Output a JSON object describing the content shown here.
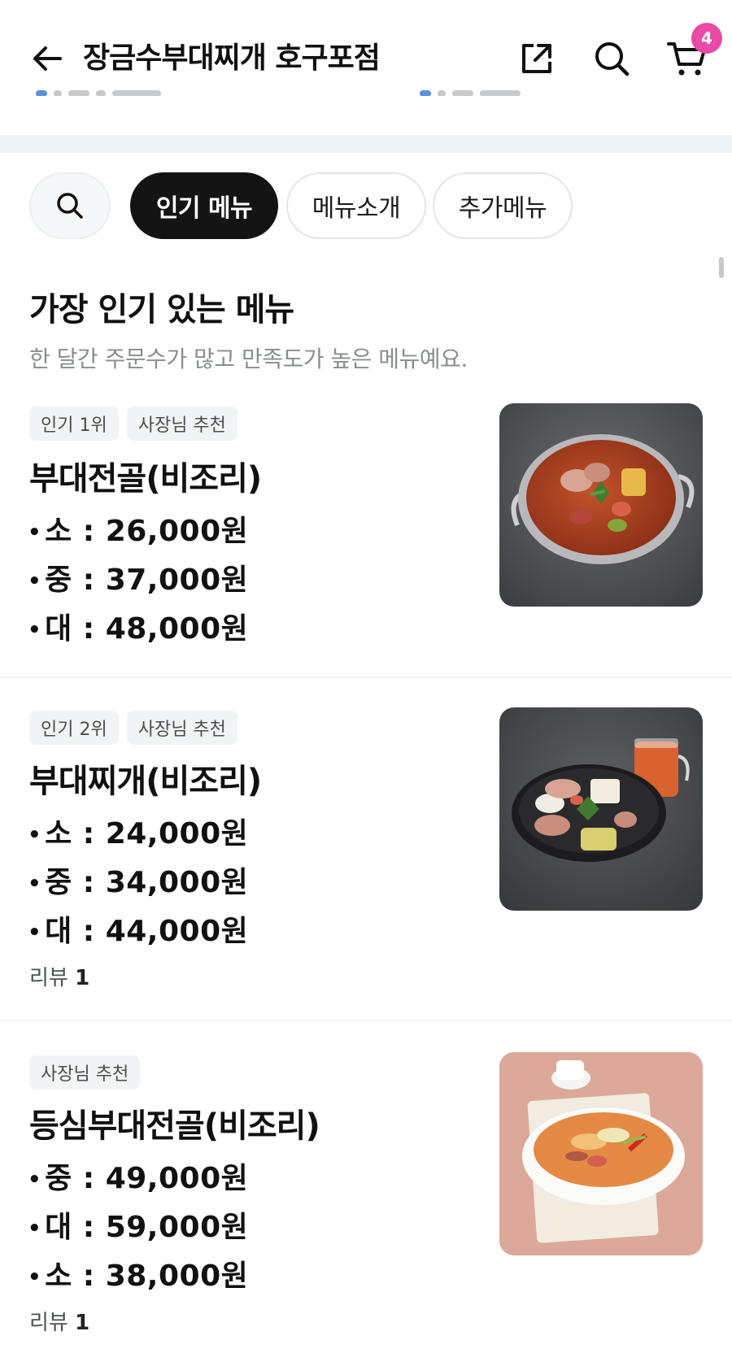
{
  "header": {
    "title": "장금수부대찌개 호구포점",
    "cart_count": "4"
  },
  "tabs": [
    {
      "label": "인기 메뉴",
      "active": true
    },
    {
      "label": "메뉴소개",
      "active": false
    },
    {
      "label": "추가메뉴",
      "active": false
    }
  ],
  "section": {
    "title": "가장 인기 있는 메뉴",
    "subtitle": "한 달간 주문수가 많고 만족도가 높은 메뉴예요."
  },
  "items": [
    {
      "badges": [
        "인기 1위",
        "사장님 추천"
      ],
      "name": "부대전골(비조리)",
      "prices": [
        "소 : 26,000원",
        "중 : 37,000원",
        "대 : 48,000원"
      ],
      "review_label": "",
      "review_count": ""
    },
    {
      "badges": [
        "인기 2위",
        "사장님 추천"
      ],
      "name": "부대찌개(비조리)",
      "prices": [
        "소 : 24,000원",
        "중 : 34,000원",
        "대 : 44,000원"
      ],
      "review_label": "리뷰",
      "review_count": "1"
    },
    {
      "badges": [
        "사장님 추천"
      ],
      "name": "등심부대전골(비조리)",
      "prices": [
        "중 : 49,000원",
        "대 : 59,000원",
        "소 : 38,000원"
      ],
      "review_label": "리뷰",
      "review_count": "1"
    }
  ],
  "icons": {
    "back": "arrow-left-icon",
    "share": "share-icon",
    "search": "search-icon",
    "cart": "cart-icon"
  },
  "colors": {
    "badge_pink": "#e84aa6",
    "active_tab": "#141414",
    "tag_bg": "#f2f3f5",
    "subtitle_gray": "#8a8d91"
  }
}
